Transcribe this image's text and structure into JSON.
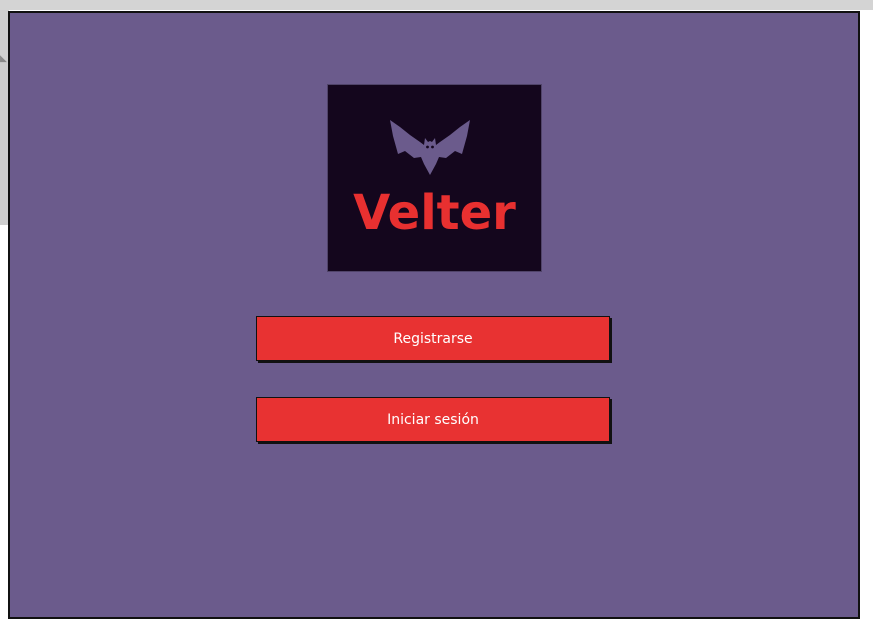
{
  "logo": {
    "text": "Velter",
    "icon": "bat-icon",
    "background_color": "#14061d",
    "text_color": "#e83030",
    "icon_color": "#6b5b8c"
  },
  "actions": {
    "register_label": "Registrarse",
    "login_label": "Iniciar sesión"
  },
  "colors": {
    "page_background": "#6b5b8c",
    "button_background": "#e83232",
    "button_text": "#ffffff"
  }
}
